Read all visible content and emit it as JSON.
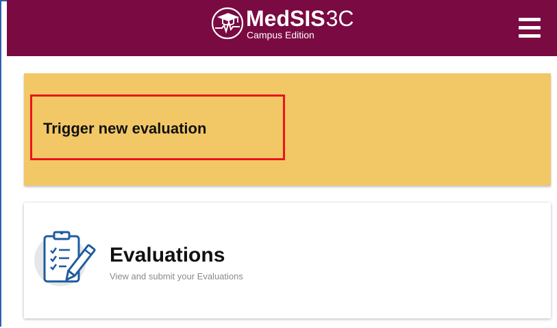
{
  "header": {
    "brand_main": "MedSIS",
    "brand_suffix": "3C",
    "brand_sub": "Campus Edition",
    "menu_icon": "hamburger-menu-icon",
    "logo_icon": "graduation-cap-heartbeat-logo"
  },
  "cards": {
    "trigger": {
      "label": "Trigger new evaluation",
      "highlight_color": "#e8141c"
    },
    "evaluations": {
      "title": "Evaluations",
      "subtitle": "View and submit your Evaluations",
      "icon": "clipboard-checklist-pencil-icon"
    }
  },
  "colors": {
    "header_bg": "#7a0a42",
    "trigger_card_bg": "#f2c766",
    "card_bg": "#ffffff",
    "text": "#111111",
    "subtle_text": "#8a8a8a"
  }
}
